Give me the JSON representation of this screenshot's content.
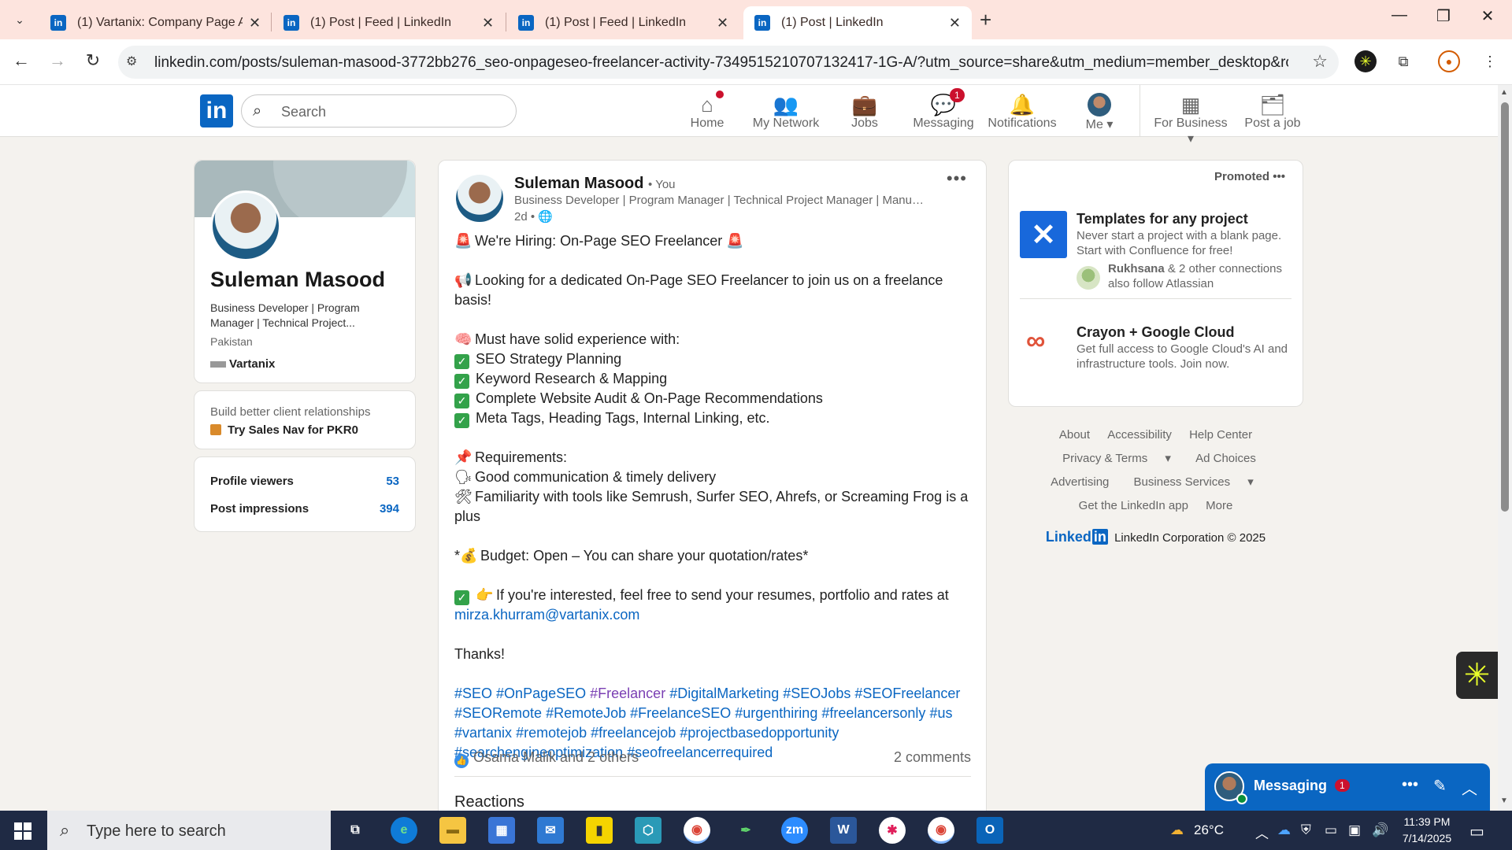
{
  "browser": {
    "tabs": [
      {
        "title": "(1) Vartanix: Company Page Ad",
        "active": false
      },
      {
        "title": "(1) Post | Feed | LinkedIn",
        "active": false
      },
      {
        "title": "(1) Post | Feed | LinkedIn",
        "active": false
      },
      {
        "title": "(1) Post | LinkedIn",
        "active": true
      }
    ],
    "url": "linkedin.com/posts/suleman-masood-3772bb276_seo-onpageseo-freelancer-activity-7349515210707132417-1G-A/?utm_source=share&utm_medium=member_desktop&rcm=ACoAAEN..."
  },
  "linkedin_header": {
    "search_placeholder": "Search",
    "nav": [
      {
        "label": "Home",
        "badge": "",
        "dot": true
      },
      {
        "label": "My Network",
        "badge": ""
      },
      {
        "label": "Jobs",
        "badge": ""
      },
      {
        "label": "Messaging",
        "badge": "1"
      },
      {
        "label": "Notifications",
        "badge": ""
      },
      {
        "label": "Me",
        "badge": ""
      },
      {
        "label": "For Business",
        "badge": ""
      },
      {
        "label": "Post a job",
        "badge": ""
      }
    ]
  },
  "profile": {
    "name": "Suleman Masood",
    "headline": "Business Developer | Program Manager | Technical Project...",
    "location": "Pakistan",
    "company": "Vartanix",
    "sales_nav_line1": "Build better client relationships",
    "sales_nav_line2": "Try Sales Nav for PKR0",
    "stats": [
      {
        "label": "Profile viewers",
        "value": "53"
      },
      {
        "label": "Post impressions",
        "value": "394"
      }
    ]
  },
  "post": {
    "author": "Suleman Masood",
    "you": "• You",
    "headline": "Business Developer | Program Manager | Technical Project Manager | Manual ...",
    "time": "2d •",
    "lines": {
      "l1": "We're Hiring: On-Page SEO Freelancer",
      "l2": "Looking for a dedicated On-Page SEO Freelancer to join us on a freelance basis!",
      "l3": "Must have solid experience with:",
      "l4": "SEO Strategy Planning",
      "l5": "Keyword Research & Mapping",
      "l6": "Complete Website Audit & On-Page Recommendations",
      "l7": "Meta Tags, Heading Tags, Internal Linking, etc.",
      "l8": "Requirements:",
      "l9": "Good communication & timely delivery",
      "l10": "Familiarity with tools like Semrush, Surfer SEO, Ahrefs, or Screaming Frog is a plus",
      "l11": "Budget: Open – You can share your quotation/rates*",
      "l11_prefix": "*",
      "l12": "If you're interested, feel free to send your resumes, portfolio and rates at",
      "email": "mirza.khurram@vartanix.com",
      "thanks": "Thanks!"
    },
    "hashtags": {
      "h1": "#SEO",
      "h2": "#OnPageSEO",
      "h3": "#Freelancer",
      "h4": "#DigitalMarketing",
      "h5": "#SEOJobs",
      "h6": "#SEOFreelancer",
      "h7": "#SEORemote",
      "h8": "#RemoteJob",
      "h9": "#FreelanceSEO",
      "h10": "#urgenthiring",
      "h11": "#freelancersonly",
      "h12": "#us",
      "h13": "#vartanix",
      "h14": "#remotejob",
      "h15": "#freelancejob",
      "h16": "#projectbasedopportunity",
      "h17": "#searchengineoptimization",
      "h18": "#seofreelancerrequired"
    },
    "reactions_text": "Osama Malik and 2 others",
    "comments_text": "2 comments",
    "reactions_heading": "Reactions"
  },
  "ads": {
    "promoted": "Promoted",
    "ad1_title": "Templates for any project",
    "ad1_desc": "Never start a project with a blank page. Start with Confluence for free!",
    "ad1_conn_name": "Rukhsana",
    "ad1_conn_rest": "& 2 other connections also follow Atlassian",
    "ad2_title": "Crayon + Google Cloud",
    "ad2_desc": "Get full access to Google Cloud's AI and infrastructure tools. Join now."
  },
  "footer": {
    "links": {
      "about": "About",
      "accessibility": "Accessibility",
      "help": "Help Center",
      "privacy": "Privacy & Terms",
      "adchoices": "Ad Choices",
      "advertising": "Advertising",
      "business": "Business Services",
      "app": "Get the LinkedIn app",
      "more": "More"
    },
    "logo": "Linked",
    "copyright": "LinkedIn Corporation © 2025"
  },
  "messaging": {
    "title": "Messaging",
    "badge": "1"
  },
  "taskbar": {
    "search_placeholder": "Type here to search",
    "weather": "26°C",
    "time": "11:39 PM",
    "date": "7/14/2025"
  },
  "colors": {
    "linkedin_blue": "#0a66c2",
    "badge_red": "#cb112d",
    "tab_bg": "#fde4de"
  }
}
